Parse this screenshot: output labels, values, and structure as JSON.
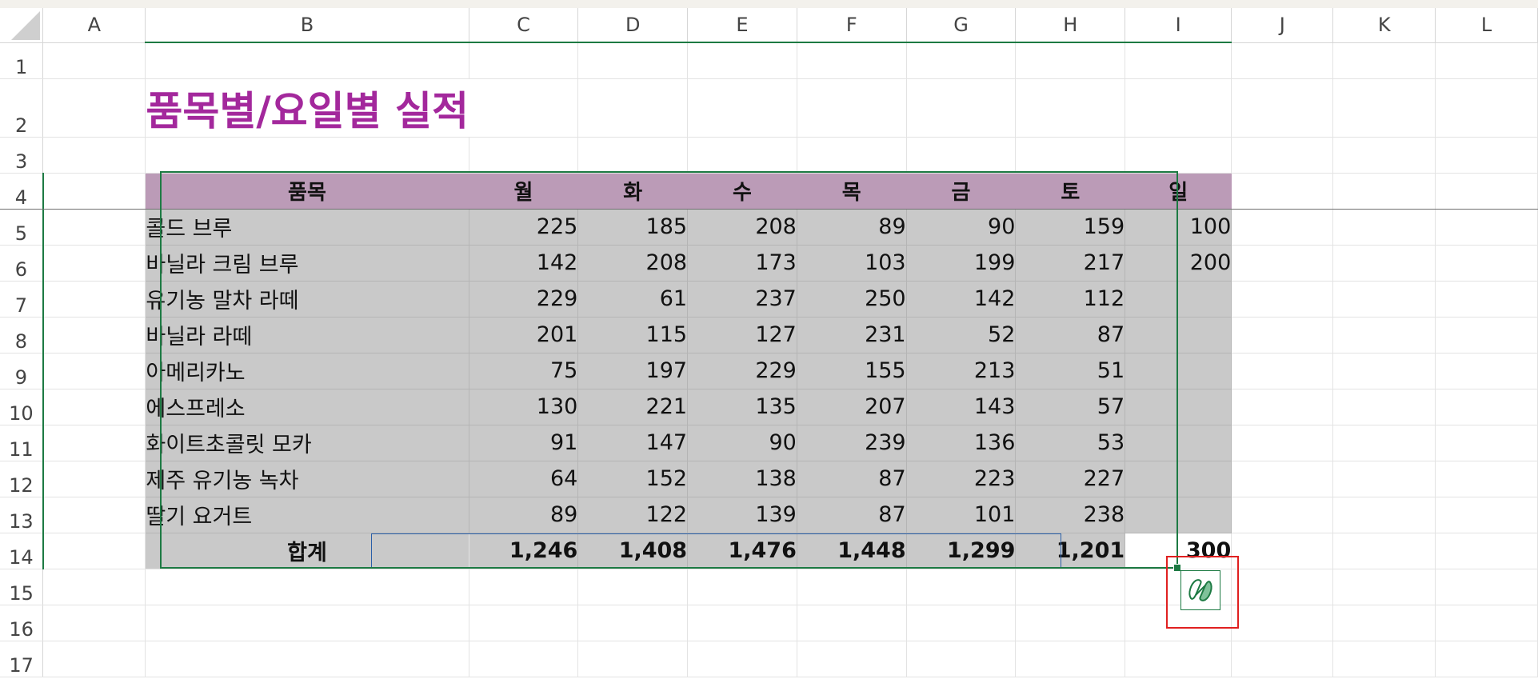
{
  "columns": [
    "A",
    "B",
    "C",
    "D",
    "E",
    "F",
    "G",
    "H",
    "I",
    "J",
    "K",
    "L"
  ],
  "rows": [
    "1",
    "2",
    "3",
    "4",
    "5",
    "6",
    "7",
    "8",
    "9",
    "10",
    "11",
    "12",
    "13",
    "14",
    "15",
    "16",
    "17"
  ],
  "title": "품목별/요일별 실적",
  "table": {
    "headers": [
      "품목",
      "월",
      "화",
      "수",
      "목",
      "금",
      "토",
      "일"
    ],
    "body": [
      [
        "콜드 브루",
        "225",
        "185",
        "208",
        "89",
        "90",
        "159",
        "100"
      ],
      [
        "바닐라 크림 브루",
        "142",
        "208",
        "173",
        "103",
        "199",
        "217",
        "200"
      ],
      [
        "유기농 말차 라떼",
        "229",
        "61",
        "237",
        "250",
        "142",
        "112",
        ""
      ],
      [
        "바닐라 라떼",
        "201",
        "115",
        "127",
        "231",
        "52",
        "87",
        ""
      ],
      [
        "아메리카노",
        "75",
        "197",
        "229",
        "155",
        "213",
        "51",
        ""
      ],
      [
        "에스프레소",
        "130",
        "221",
        "135",
        "207",
        "143",
        "57",
        ""
      ],
      [
        "화이트초콜릿 모카",
        "91",
        "147",
        "90",
        "239",
        "136",
        "53",
        ""
      ],
      [
        "제주 유기농 녹차",
        "64",
        "152",
        "138",
        "87",
        "223",
        "227",
        ""
      ],
      [
        "딸기 요거트",
        "89",
        "122",
        "139",
        "87",
        "101",
        "238",
        ""
      ]
    ],
    "total": [
      "합계",
      "1,246",
      "1,408",
      "1,476",
      "1,448",
      "1,299",
      "1,201",
      "300"
    ]
  },
  "colors": {
    "title": "#a3289c",
    "header_fill": "#bb9bb7",
    "body_fill": "#c9c9c9",
    "accent": "#1d7a43",
    "highlight": "#e02020"
  },
  "icons": {
    "copilot": "copilot-icon"
  }
}
